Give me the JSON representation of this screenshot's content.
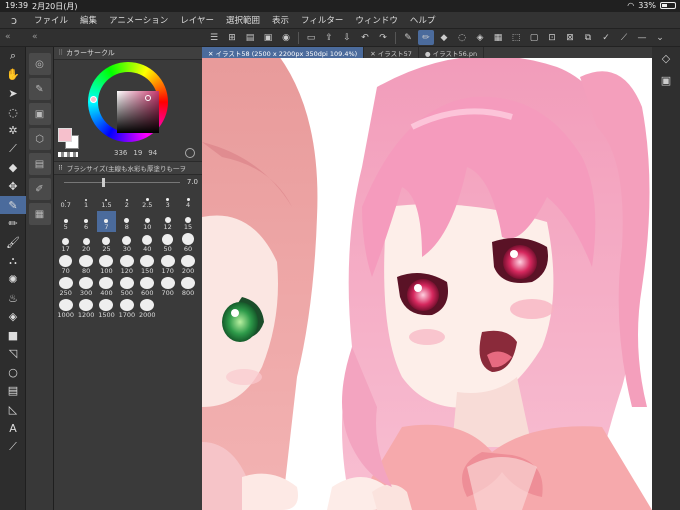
{
  "status": {
    "time": "19:39",
    "date": "2月20日(月)",
    "battery": "33%"
  },
  "menu": {
    "items": [
      "ファイル",
      "編集",
      "アニメーション",
      "レイヤー",
      "選択範囲",
      "表示",
      "フィルター",
      "ウィンドウ",
      "ヘルプ"
    ]
  },
  "left_header": {
    "left": "«",
    "right": "«"
  },
  "tabs": [
    {
      "label": "✕ イラスト58 (2500 x 2200px 350dpi 109.4%)"
    },
    {
      "label": "✕ イラスト57"
    },
    {
      "label": "● イラスト56.pn"
    }
  ],
  "color_panel": {
    "title": "カラーサークル",
    "main_color": "#f6c0cc",
    "sub_color": "#ffffff",
    "h": "336",
    "s": "19",
    "v": "94"
  },
  "brush_panel": {
    "title": "ブラシサイズ(主線も水彩も厚塗りも一ヲ",
    "value": "7.0",
    "sizes": [
      "0.7",
      "1",
      "1.5",
      "2",
      "2.5",
      "3",
      "4",
      "5",
      "6",
      "7",
      "8",
      "10",
      "12",
      "15",
      "17",
      "20",
      "25",
      "30",
      "40",
      "50",
      "60",
      "70",
      "80",
      "100",
      "120",
      "150",
      "170",
      "200",
      "250",
      "300",
      "400",
      "500",
      "600",
      "700",
      "800",
      "1000",
      "1200",
      "1500",
      "1700",
      "2000"
    ],
    "selected": "7"
  },
  "colors": {
    "accent": "#4b6b9c",
    "panel": "#3a3a3a",
    "dark": "#2b2b2b"
  }
}
